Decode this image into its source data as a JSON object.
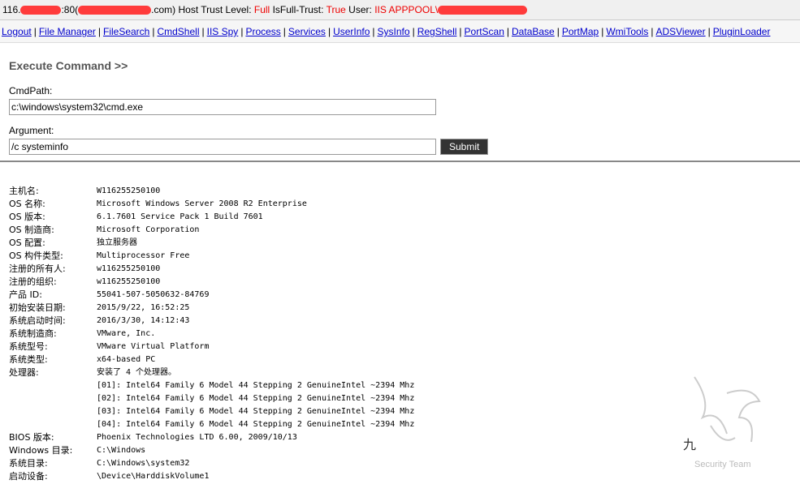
{
  "topbar": {
    "host_prefix": "116.",
    "port": ":80(",
    "host_suffix": ".com)",
    "trust_label": "Host Trust Level:",
    "trust_value": "Full",
    "fulltrust_label": "IsFull-Trust:",
    "fulltrust_value": "True",
    "user_label": "User:",
    "user_value": "IIS APPPOOL\\"
  },
  "nav": [
    "Logout",
    "File Manager",
    "FileSearch",
    "CmdShell",
    "IIS Spy",
    "Process",
    "Services",
    "UserInfo",
    "SysInfo",
    "RegShell",
    "PortScan",
    "DataBase",
    "PortMap",
    "WmiTools",
    "ADSViewer",
    "PluginLoader"
  ],
  "form": {
    "title": "Execute Command >>",
    "cmdpath_label": "CmdPath:",
    "cmdpath_value": "c:\\windows\\system32\\cmd.exe",
    "argument_label": "Argument:",
    "argument_value": "/c systeminfo",
    "submit_label": "Submit"
  },
  "output": [
    [
      "主机名:",
      "W116255250100"
    ],
    [
      "OS 名称:",
      "Microsoft Windows Server 2008 R2 Enterprise"
    ],
    [
      "OS 版本:",
      "6.1.7601 Service Pack 1 Build 7601"
    ],
    [
      "OS 制造商:",
      "Microsoft Corporation"
    ],
    [
      "OS 配置:",
      "独立服务器"
    ],
    [
      "OS 构件类型:",
      "Multiprocessor Free"
    ],
    [
      "注册的所有人:",
      "w116255250100"
    ],
    [
      "注册的组织:",
      "w116255250100"
    ],
    [
      "产品 ID:",
      "55041-507-5050632-84769"
    ],
    [
      "初始安装日期:",
      "2015/9/22, 16:52:25"
    ],
    [
      "系统启动时间:",
      "2016/3/30, 14:12:43"
    ],
    [
      "系统制造商:",
      "VMware, Inc."
    ],
    [
      "系统型号:",
      "VMware Virtual Platform"
    ],
    [
      "系统类型:",
      "x64-based PC"
    ],
    [
      "处理器:",
      "安装了 4 个处理器。"
    ],
    [
      "",
      "[01]: Intel64 Family 6 Model 44 Stepping 2 GenuineIntel ~2394 Mhz"
    ],
    [
      "",
      "[02]: Intel64 Family 6 Model 44 Stepping 2 GenuineIntel ~2394 Mhz"
    ],
    [
      "",
      "[03]: Intel64 Family 6 Model 44 Stepping 2 GenuineIntel ~2394 Mhz"
    ],
    [
      "",
      "[04]: Intel64 Family 6 Model 44 Stepping 2 GenuineIntel ~2394 Mhz"
    ],
    [
      "BIOS 版本:",
      "Phoenix Technologies LTD 6.00, 2009/10/13"
    ],
    [
      "Windows 目录:",
      "C:\\Windows"
    ],
    [
      "系统目录:",
      "C:\\Windows\\system32"
    ],
    [
      "启动设备:",
      "\\Device\\HarddiskVolume1"
    ]
  ],
  "watermark": {
    "glyph": "九",
    "text": "Security Team"
  }
}
